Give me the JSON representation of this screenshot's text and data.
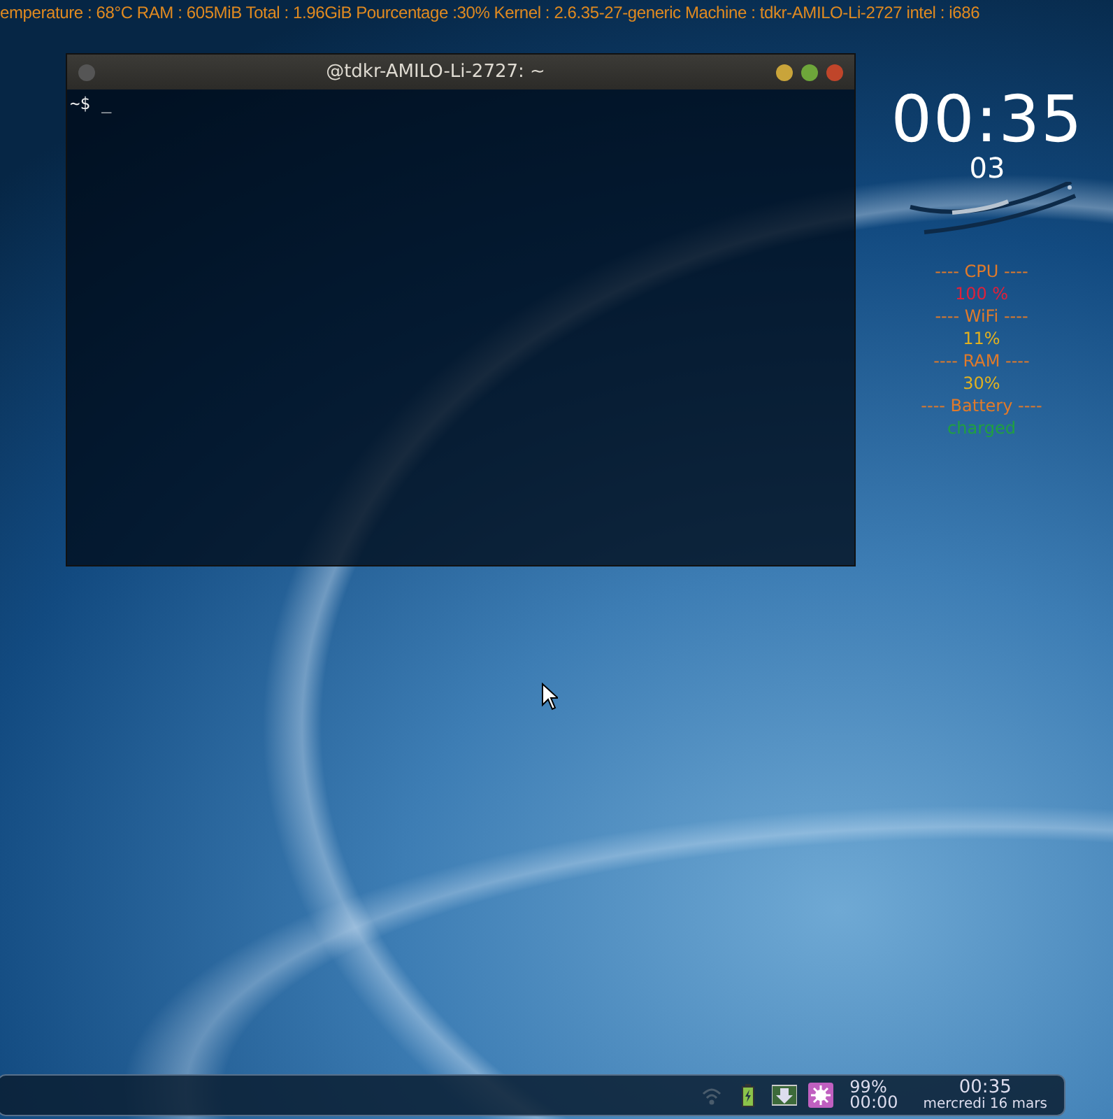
{
  "top_bar": {
    "text": "emperature : 68°C  RAM : 605MiB  Total : 1.96GiB  Pourcentage :30%  Kernel : 2.6.35-27-generic  Machine : tdkr-AMILO-Li-2727  intel : i686"
  },
  "terminal": {
    "title": "@tdkr-AMILO-Li-2727: ~",
    "prompt": "~$",
    "cursor": "_"
  },
  "clock_widget": {
    "time": "00:35",
    "seconds": "03"
  },
  "system_monitor": [
    {
      "text": "---- CPU ----",
      "color": "#e07a2a"
    },
    {
      "text": "100 %",
      "color": "#e0203a"
    },
    {
      "text": "---- WiFi ----",
      "color": "#e07a2a"
    },
    {
      "text": "11%",
      "color": "#e0b020"
    },
    {
      "text": "---- RAM ----",
      "color": "#e07a2a"
    },
    {
      "text": "30%",
      "color": "#e0b020"
    },
    {
      "text": "---- Battery ----",
      "color": "#e07a2a"
    },
    {
      "text": "charged",
      "color": "#20a040"
    }
  ],
  "panel": {
    "battery_percent": "99%",
    "battery_time": "00:00",
    "time": "00:35",
    "date": "mercredi 16 mars"
  }
}
